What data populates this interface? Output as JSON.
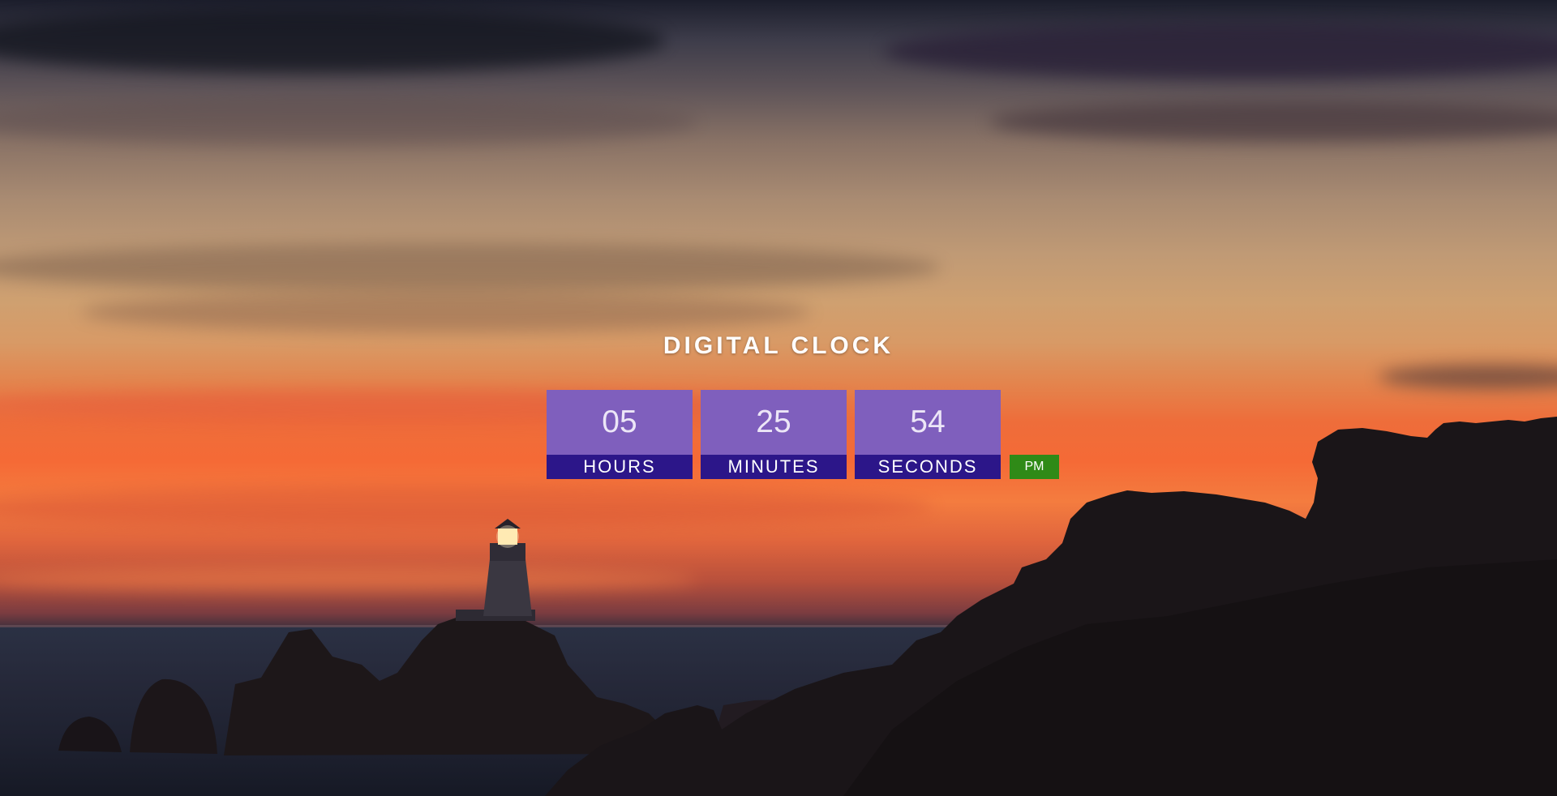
{
  "clock": {
    "title": "DIGITAL CLOCK",
    "hours": "05",
    "minutes": "25",
    "seconds": "54",
    "hours_label": "HOURS",
    "minutes_label": "MINUTES",
    "seconds_label": "SECONDS",
    "period": "PM"
  },
  "colors": {
    "digit_box": "#7f5fbd",
    "label_bar": "#2c1689",
    "period_badge": "#2f8a17"
  }
}
